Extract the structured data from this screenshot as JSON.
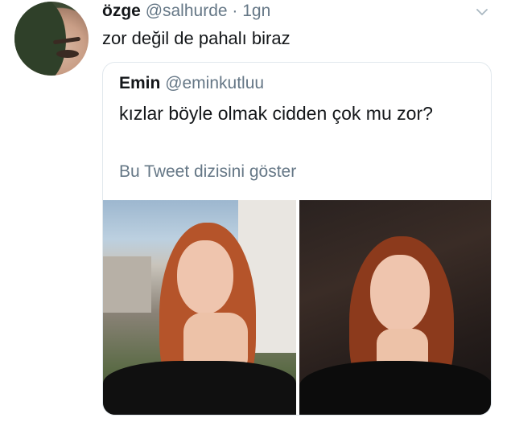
{
  "tweet": {
    "author_name": "özge",
    "author_handle": "@salhurde",
    "separator": "·",
    "time": "1gn",
    "text": "zor değil de pahalı biraz",
    "menu_icon": "chevron-down-icon"
  },
  "quoted": {
    "author_name": "Emin",
    "author_handle": "@eminkutluu",
    "text": "kızlar böyle olmak cidden çok mu zor?",
    "show_thread_label": "Bu Tweet dizisini göster",
    "photos": [
      "photo-1",
      "photo-2"
    ]
  },
  "colors": {
    "text": "#14171a",
    "secondary": "#657786",
    "border": "#e1e8ed"
  }
}
